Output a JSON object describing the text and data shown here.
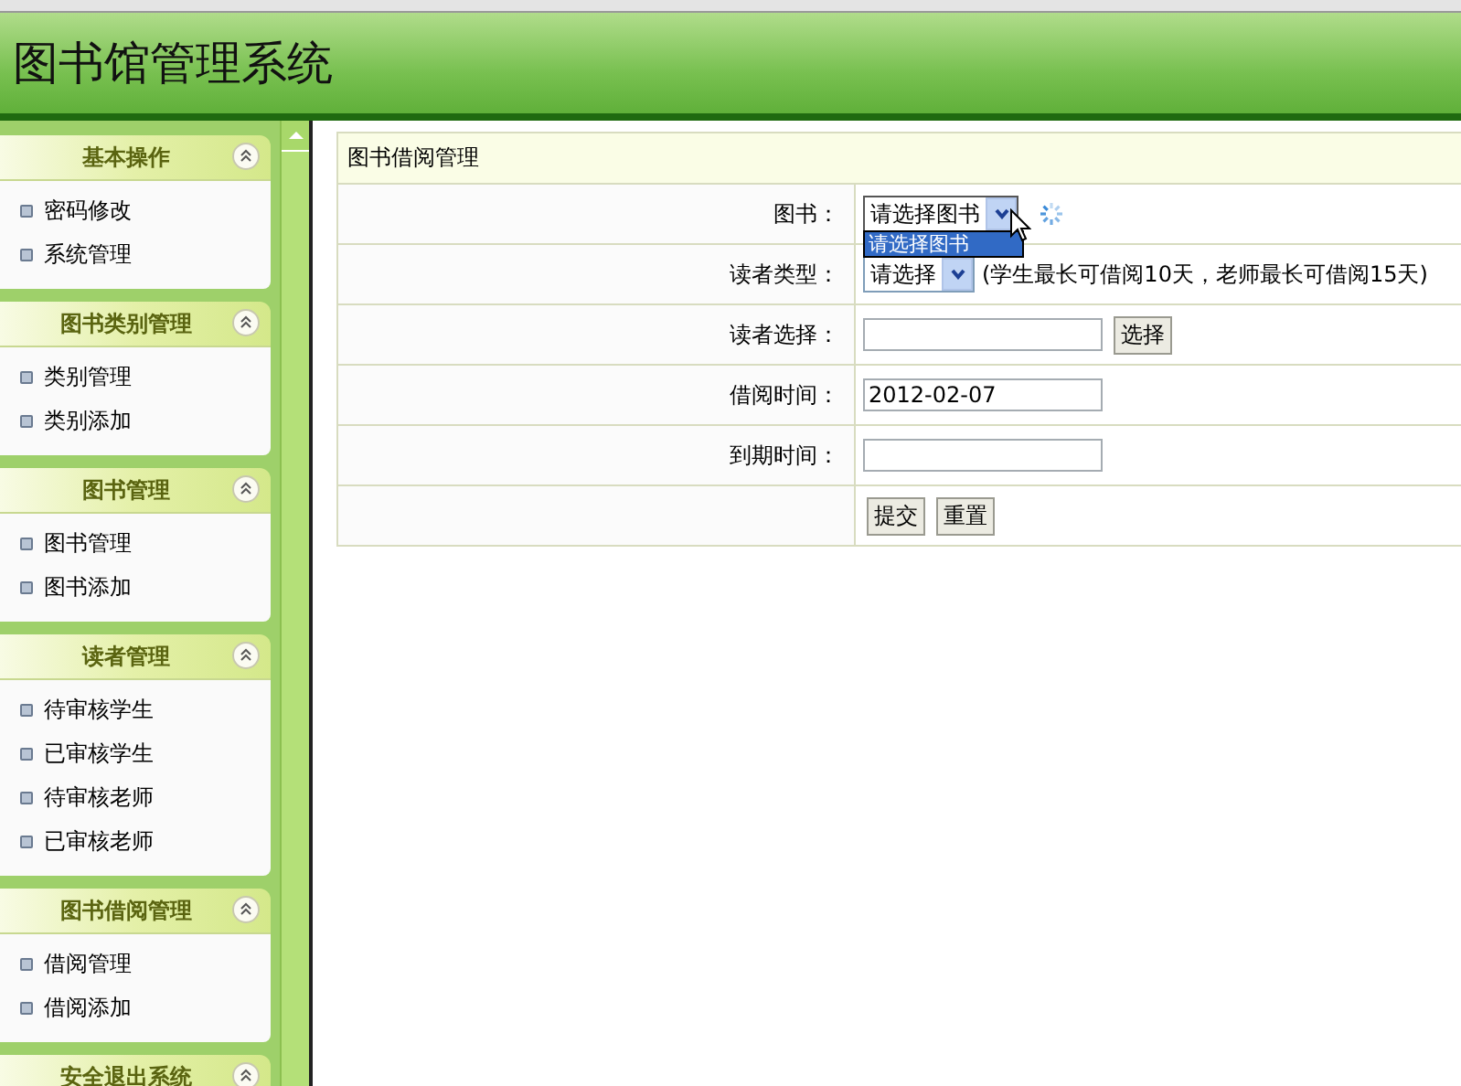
{
  "app_title": "图书馆管理系统",
  "sidebar": {
    "groups": [
      {
        "title": "基本操作",
        "expanded": true,
        "items": [
          "密码修改",
          "系统管理"
        ]
      },
      {
        "title": "图书类别管理",
        "expanded": true,
        "items": [
          "类别管理",
          "类别添加"
        ]
      },
      {
        "title": "图书管理",
        "expanded": true,
        "items": [
          "图书管理",
          "图书添加"
        ]
      },
      {
        "title": "读者管理",
        "expanded": true,
        "items": [
          "待审核学生",
          "已审核学生",
          "待审核老师",
          "已审核老师"
        ]
      },
      {
        "title": "图书借阅管理",
        "expanded": true,
        "items": [
          "借阅管理",
          "借阅添加"
        ]
      },
      {
        "title": "安全退出系统",
        "expanded": true
      }
    ]
  },
  "panel": {
    "title": "图书借阅管理",
    "fields": [
      {
        "kind": "select",
        "label": "图书：",
        "value": "请选择图书",
        "expanded": true,
        "loading": true,
        "options": [
          {
            "label": "请选择图书",
            "selected": true
          }
        ]
      },
      {
        "kind": "select",
        "label": "读者类型：",
        "value": "请选择",
        "expanded": false,
        "note": "(学生最长可借阅10天，老师最长可借阅15天)"
      },
      {
        "kind": "text-button",
        "label": "读者选择：",
        "button": "选择"
      },
      {
        "kind": "text",
        "label": "借阅时间：",
        "value": "2012-02-07"
      },
      {
        "kind": "text",
        "label": "到期时间："
      }
    ],
    "buttons": [
      "提交",
      "重置"
    ]
  }
}
